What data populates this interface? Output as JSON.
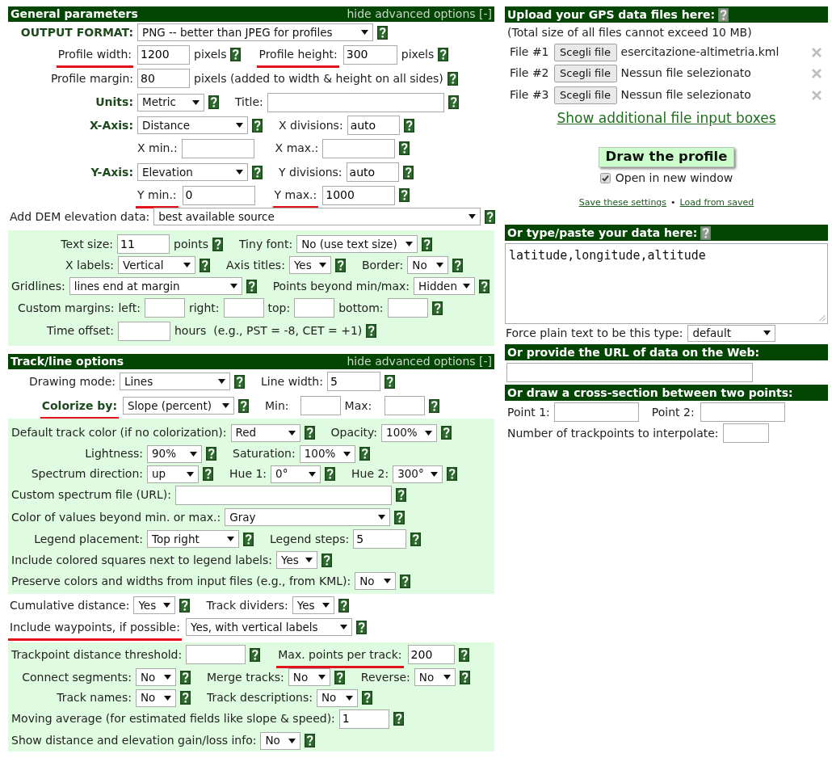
{
  "sections": [
    {
      "title": "General parameters",
      "toggle": "hide advanced options [-]",
      "blocks": [
        {
          "kind": "basic",
          "lines": [
            {
              "items": [
                {
                  "kind": "key_label",
                  "text": "OUTPUT FORMAT:",
                  "underlined": false
                },
                {
                  "kind": "select",
                  "value": "PNG -- better than JPEG for profiles"
                },
                {
                  "kind": "help"
                }
              ]
            },
            {
              "items": [
                {
                  "kind": "label",
                  "text": "Profile width:",
                  "underlined": true
                },
                {
                  "kind": "input",
                  "value": "1200"
                },
                {
                  "kind": "text",
                  "text": "pixels"
                },
                {
                  "kind": "help"
                },
                {
                  "kind": "label",
                  "text": "Profile height:",
                  "underlined": true
                },
                {
                  "kind": "input",
                  "value": "300"
                },
                {
                  "kind": "text",
                  "text": "pixels"
                },
                {
                  "kind": "help"
                }
              ]
            },
            {
              "items": [
                {
                  "kind": "label",
                  "text": "Profile margin:",
                  "underlined": false
                },
                {
                  "kind": "input",
                  "value": "80"
                },
                {
                  "kind": "text",
                  "text": "pixels (added to width & height on all sides)"
                },
                {
                  "kind": "help"
                }
              ]
            },
            {
              "items": [
                {
                  "kind": "key_label",
                  "text": "Units:",
                  "underlined": false
                },
                {
                  "kind": "select",
                  "value": "Metric"
                },
                {
                  "kind": "help"
                },
                {
                  "kind": "label",
                  "text": "Title:",
                  "underlined": false
                },
                {
                  "kind": "input"
                },
                {
                  "kind": "help"
                }
              ]
            },
            {
              "items": [
                {
                  "kind": "key_label",
                  "text": "X-Axis:",
                  "underlined": false
                },
                {
                  "kind": "select",
                  "value": "Distance"
                },
                {
                  "kind": "help"
                },
                {
                  "kind": "label",
                  "text": "X divisions:",
                  "underlined": false
                },
                {
                  "kind": "input",
                  "value": "auto"
                },
                {
                  "kind": "help"
                }
              ]
            },
            {
              "items": [
                {
                  "kind": "label",
                  "text": "X min.:",
                  "underlined": false
                },
                {
                  "kind": "input"
                },
                {
                  "kind": "label",
                  "text": "X max.:",
                  "underlined": false
                },
                {
                  "kind": "input"
                },
                {
                  "kind": "help"
                }
              ]
            },
            {
              "items": [
                {
                  "kind": "key_label",
                  "text": "Y-Axis:",
                  "underlined": false
                },
                {
                  "kind": "select",
                  "value": "Elevation"
                },
                {
                  "kind": "help"
                },
                {
                  "kind": "label",
                  "text": "Y divisions:",
                  "underlined": false
                },
                {
                  "kind": "input",
                  "value": "auto"
                },
                {
                  "kind": "help"
                }
              ]
            },
            {
              "items": [
                {
                  "kind": "label",
                  "text": "Y min.:",
                  "underlined": true
                },
                {
                  "kind": "input",
                  "value": "0"
                },
                {
                  "kind": "label",
                  "text": "Y max.:",
                  "underlined": true
                },
                {
                  "kind": "input",
                  "value": "1000"
                },
                {
                  "kind": "help"
                }
              ]
            },
            {
              "items": [
                {
                  "kind": "label",
                  "text": "Add DEM elevation data:",
                  "underlined": false
                },
                {
                  "kind": "select",
                  "value": "best available source"
                },
                {
                  "kind": "help"
                }
              ]
            }
          ]
        },
        {
          "kind": "advanced",
          "lines": [
            {
              "items": [
                {
                  "kind": "label",
                  "text": "Text size:",
                  "underlined": false
                },
                {
                  "kind": "input",
                  "value": "11"
                },
                {
                  "kind": "text",
                  "text": "points"
                },
                {
                  "kind": "help"
                },
                {
                  "kind": "label",
                  "text": "Tiny font:",
                  "underlined": false
                },
                {
                  "kind": "select",
                  "value": "No (use text size)"
                },
                {
                  "kind": "help"
                }
              ]
            },
            {
              "items": [
                {
                  "kind": "label",
                  "text": "X labels:",
                  "underlined": false
                },
                {
                  "kind": "select",
                  "value": "Vertical"
                },
                {
                  "kind": "help"
                },
                {
                  "kind": "label",
                  "text": "Axis titles:",
                  "underlined": false
                },
                {
                  "kind": "select",
                  "value": "Yes"
                },
                {
                  "kind": "help"
                },
                {
                  "kind": "label",
                  "text": "Border:",
                  "underlined": false
                },
                {
                  "kind": "select",
                  "value": "No"
                },
                {
                  "kind": "help"
                }
              ]
            },
            {
              "items": [
                {
                  "kind": "label",
                  "text": "Gridlines:",
                  "underlined": false
                },
                {
                  "kind": "select",
                  "value": "lines end at margin"
                },
                {
                  "kind": "help"
                },
                {
                  "kind": "label",
                  "text": "Points beyond min/max:",
                  "underlined": false
                },
                {
                  "kind": "select",
                  "value": "Hidden"
                },
                {
                  "kind": "help"
                }
              ]
            },
            {
              "items": [
                {
                  "kind": "label",
                  "text": "Custom margins:",
                  "underlined": false
                },
                {
                  "kind": "label",
                  "text": "left:",
                  "underlined": false
                },
                {
                  "kind": "input"
                },
                {
                  "kind": "label",
                  "text": "right:",
                  "underlined": false
                },
                {
                  "kind": "input"
                },
                {
                  "kind": "label",
                  "text": "top:",
                  "underlined": false
                },
                {
                  "kind": "input"
                },
                {
                  "kind": "label",
                  "text": "bottom:",
                  "underlined": false
                },
                {
                  "kind": "input"
                },
                {
                  "kind": "help"
                }
              ]
            },
            {
              "items": [
                {
                  "kind": "label",
                  "text": "Time offset:",
                  "underlined": false
                },
                {
                  "kind": "input"
                },
                {
                  "kind": "text",
                  "text": "hours  (e.g., PST = -8, CET = +1)"
                },
                {
                  "kind": "help"
                }
              ]
            }
          ]
        }
      ]
    },
    {
      "title": "Track/line options",
      "toggle": "hide advanced options [-]",
      "blocks": [
        {
          "kind": "basic",
          "lines": [
            {
              "items": [
                {
                  "kind": "label",
                  "text": "Drawing mode:",
                  "underlined": false
                },
                {
                  "kind": "select",
                  "value": "Lines"
                },
                {
                  "kind": "help"
                },
                {
                  "kind": "label",
                  "text": "Line width:",
                  "underlined": false
                },
                {
                  "kind": "input",
                  "value": "5"
                },
                {
                  "kind": "help"
                }
              ]
            },
            {
              "items": [
                {
                  "kind": "key_label",
                  "text": "Colorize by:",
                  "underlined": true
                },
                {
                  "kind": "select",
                  "value": "Slope (percent)"
                },
                {
                  "kind": "help"
                },
                {
                  "kind": "label",
                  "text": "Min:",
                  "underlined": false
                },
                {
                  "kind": "input"
                },
                {
                  "kind": "label",
                  "text": "Max:",
                  "underlined": false
                },
                {
                  "kind": "input"
                },
                {
                  "kind": "help"
                }
              ]
            }
          ]
        },
        {
          "kind": "advanced",
          "lines": [
            {
              "items": [
                {
                  "kind": "label",
                  "text": "Default track color (if no colorization):",
                  "underlined": false
                },
                {
                  "kind": "select",
                  "value": "Red"
                },
                {
                  "kind": "help"
                },
                {
                  "kind": "label",
                  "text": "Opacity:",
                  "underlined": false
                },
                {
                  "kind": "select",
                  "value": "100%"
                },
                {
                  "kind": "help"
                }
              ]
            },
            {
              "items": [
                {
                  "kind": "label",
                  "text": "Lightness:",
                  "underlined": false
                },
                {
                  "kind": "select",
                  "value": "90%"
                },
                {
                  "kind": "help"
                },
                {
                  "kind": "label",
                  "text": "Saturation:",
                  "underlined": false
                },
                {
                  "kind": "select",
                  "value": "100%"
                },
                {
                  "kind": "help"
                }
              ]
            },
            {
              "items": [
                {
                  "kind": "label",
                  "text": "Spectrum direction:",
                  "underlined": false
                },
                {
                  "kind": "select",
                  "value": "up"
                },
                {
                  "kind": "help"
                },
                {
                  "kind": "label",
                  "text": "Hue 1:",
                  "underlined": false
                },
                {
                  "kind": "select",
                  "value": "0°"
                },
                {
                  "kind": "help"
                },
                {
                  "kind": "label",
                  "text": "Hue 2:",
                  "underlined": false
                },
                {
                  "kind": "select",
                  "value": "300°"
                },
                {
                  "kind": "help"
                }
              ]
            },
            {
              "items": [
                {
                  "kind": "label",
                  "text": "Custom spectrum file (URL):",
                  "underlined": false
                },
                {
                  "kind": "input"
                },
                {
                  "kind": "help"
                }
              ]
            },
            {
              "items": [
                {
                  "kind": "label",
                  "text": "Color of values beyond min. or max.:",
                  "underlined": false
                },
                {
                  "kind": "select",
                  "value": "Gray"
                },
                {
                  "kind": "help"
                }
              ]
            },
            {
              "items": [
                {
                  "kind": "label",
                  "text": "Legend placement:",
                  "underlined": false
                },
                {
                  "kind": "select",
                  "value": "Top right"
                },
                {
                  "kind": "help"
                },
                {
                  "kind": "label",
                  "text": "Legend steps:",
                  "underlined": false
                },
                {
                  "kind": "input",
                  "value": "5"
                },
                {
                  "kind": "help"
                }
              ]
            },
            {
              "items": [
                {
                  "kind": "label",
                  "text": "Include colored squares next to legend labels:",
                  "underlined": false
                },
                {
                  "kind": "select",
                  "value": "Yes"
                },
                {
                  "kind": "help"
                }
              ]
            },
            {
              "items": [
                {
                  "kind": "label",
                  "text": "Preserve colors and widths from input files (e.g., from KML):",
                  "underlined": false
                },
                {
                  "kind": "select",
                  "value": "No"
                },
                {
                  "kind": "help"
                }
              ]
            }
          ]
        },
        {
          "kind": "basic",
          "lines": [
            {
              "items": [
                {
                  "kind": "label",
                  "text": "Cumulative distance:",
                  "underlined": false
                },
                {
                  "kind": "select",
                  "value": "Yes"
                },
                {
                  "kind": "help"
                },
                {
                  "kind": "label",
                  "text": "Track dividers:",
                  "underlined": false
                },
                {
                  "kind": "select",
                  "value": "Yes"
                },
                {
                  "kind": "help"
                }
              ]
            },
            {
              "items": [
                {
                  "kind": "label",
                  "text": "Include waypoints, if possible:",
                  "underlined": true
                },
                {
                  "kind": "select",
                  "value": "Yes, with vertical labels"
                },
                {
                  "kind": "help"
                }
              ]
            }
          ]
        },
        {
          "kind": "advanced",
          "lines": [
            {
              "items": [
                {
                  "kind": "label",
                  "text": "Trackpoint distance threshold:",
                  "underlined": false
                },
                {
                  "kind": "input"
                },
                {
                  "kind": "help"
                },
                {
                  "kind": "label",
                  "text": "Max. points per track:",
                  "underlined": true
                },
                {
                  "kind": "input",
                  "value": "200"
                },
                {
                  "kind": "help"
                }
              ]
            },
            {
              "items": [
                {
                  "kind": "label",
                  "text": "Connect segments:",
                  "underlined": false
                },
                {
                  "kind": "select",
                  "value": "No"
                },
                {
                  "kind": "help"
                },
                {
                  "kind": "label",
                  "text": "Merge tracks:",
                  "underlined": false
                },
                {
                  "kind": "select",
                  "value": "No"
                },
                {
                  "kind": "help"
                },
                {
                  "kind": "label",
                  "text": "Reverse:",
                  "underlined": false
                },
                {
                  "kind": "select",
                  "value": "No"
                },
                {
                  "kind": "help"
                }
              ]
            },
            {
              "items": [
                {
                  "kind": "label",
                  "text": "Track names:",
                  "underlined": false
                },
                {
                  "kind": "select",
                  "value": "No"
                },
                {
                  "kind": "help"
                },
                {
                  "kind": "label",
                  "text": "Track descriptions:",
                  "underlined": false
                },
                {
                  "kind": "select",
                  "value": "No"
                },
                {
                  "kind": "help"
                }
              ]
            },
            {
              "items": [
                {
                  "kind": "label",
                  "text": "Moving average (for estimated fields like slope & speed):",
                  "underlined": false
                },
                {
                  "kind": "input",
                  "value": "1"
                },
                {
                  "kind": "help"
                }
              ]
            },
            {
              "items": [
                {
                  "kind": "label",
                  "text": "Show distance and elevation gain/loss info:",
                  "underlined": false
                },
                {
                  "kind": "select",
                  "value": "No"
                },
                {
                  "kind": "help"
                }
              ]
            }
          ]
        }
      ]
    }
  ],
  "upload": {
    "title": "Upload your GPS data files here:",
    "help": true,
    "note": "(Total size of all files cannot exceed 10 MB)",
    "files": [
      {
        "label": "File #1",
        "button": "Scegli file",
        "file_name": "esercitazione-altimetria.kml"
      },
      {
        "label": "File #2",
        "button": "Scegli file",
        "file_name": "Nessun file selezionato"
      },
      {
        "label": "File #3",
        "button": "Scegli file",
        "file_name": "Nessun file selezionato"
      }
    ],
    "more_link": "Show additional file input boxes",
    "submit": "Draw the profile",
    "new_window": {
      "label": "Open in new window",
      "checked": true
    },
    "links": [
      "Save these settings",
      "Load from saved"
    ],
    "link_separator": "•"
  },
  "paste": {
    "title": "Or type/paste your data here:",
    "help": true,
    "value": "latitude,longitude,altitude",
    "force_label": "Force plain text to be this type:",
    "force_value": "default"
  },
  "url": {
    "title": "Or provide the URL of data on the Web:"
  },
  "cross_section": {
    "title": "Or draw a cross-section between two points:",
    "point_1": "Point 1:",
    "point_2": "Point 2:",
    "interpolate": "Number of trackpoints to interpolate:"
  }
}
